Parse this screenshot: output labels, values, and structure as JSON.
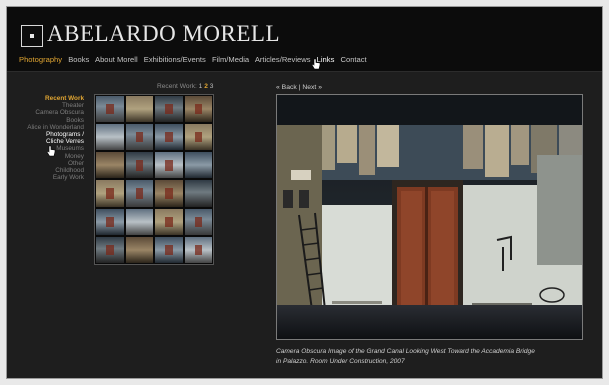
{
  "site": {
    "title": "ABELARDO MORELL"
  },
  "nav": {
    "items": [
      {
        "label": "Photography",
        "state": "active"
      },
      {
        "label": "Books",
        "state": "normal"
      },
      {
        "label": "About Morell",
        "state": "normal"
      },
      {
        "label": "Exhibitions/Events",
        "state": "normal"
      },
      {
        "label": "Film/Media",
        "state": "normal"
      },
      {
        "label": "Articles/Reviews",
        "state": "normal"
      },
      {
        "label": "Links",
        "state": "hover"
      },
      {
        "label": "Contact",
        "state": "normal"
      }
    ]
  },
  "sidebar": {
    "heading": "Recent Work",
    "items": [
      {
        "label": "Theater",
        "selected": false
      },
      {
        "label": "Camera Obscura",
        "selected": false
      },
      {
        "label": "Books",
        "selected": false
      },
      {
        "label": "Alice in Wonderland",
        "selected": false
      },
      {
        "label": "Photograms /",
        "selected": true
      },
      {
        "label": "Cliche Verres",
        "selected": true
      },
      {
        "label": "Museums",
        "selected": false
      },
      {
        "label": "Money",
        "selected": false
      },
      {
        "label": "Other",
        "selected": false
      },
      {
        "label": "Childhood",
        "selected": false
      },
      {
        "label": "Early Work",
        "selected": false
      }
    ]
  },
  "gallery": {
    "label": "Recent Work:",
    "pages": [
      "1",
      "2",
      "3"
    ],
    "current_page": "2",
    "thumbnail_count": 24
  },
  "viewer": {
    "back": "« Back",
    "separator": "|",
    "next": "Next »",
    "caption_line1": "Camera Obscura Image of the Grand Canal Looking West Toward the Accademia Bridge",
    "caption_line2": "in Palazzo. Room Under Construction, 2007"
  },
  "colors": {
    "accent": "#e0a532",
    "background": "#1e1e1e",
    "header": "#0c0c0c"
  }
}
